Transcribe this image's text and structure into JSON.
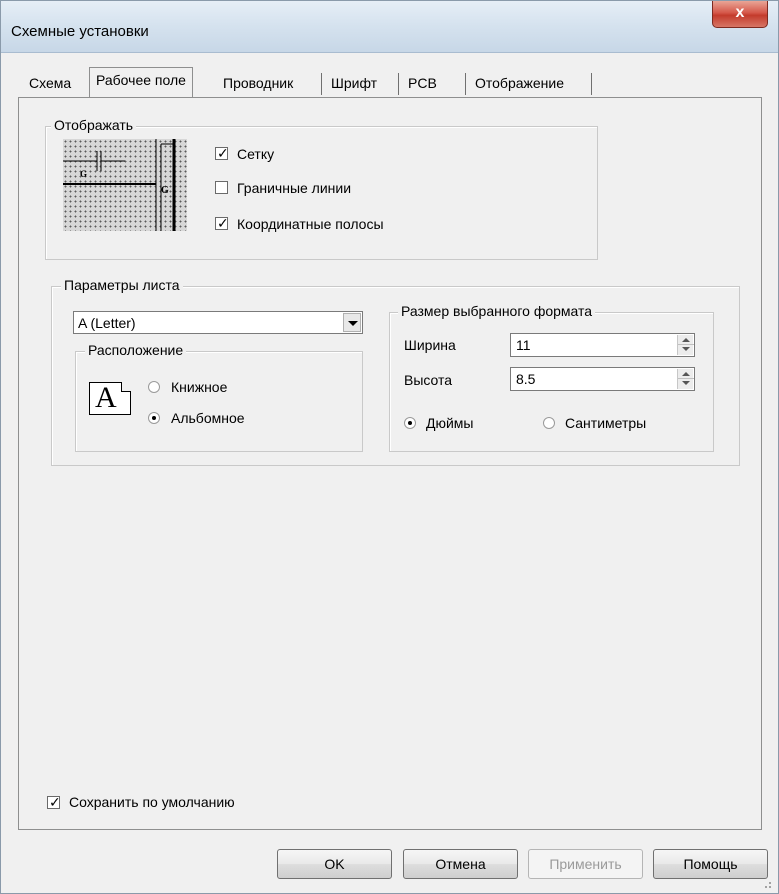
{
  "window": {
    "title": "Схемные установки",
    "close_label": "x"
  },
  "tabs": [
    {
      "label": "Схема"
    },
    {
      "label": "Рабочее поле",
      "active": true
    },
    {
      "label": "Проводник"
    },
    {
      "label": "Шрифт"
    },
    {
      "label": "PCB"
    },
    {
      "label": "Отображение"
    }
  ],
  "display_group": {
    "title": "Отображать",
    "preview_letters": {
      "left": "G",
      "right": "G"
    },
    "options": [
      {
        "label": "Сетку",
        "checked": true
      },
      {
        "label": "Граничные линии",
        "checked": false
      },
      {
        "label": "Координатные полосы",
        "checked": true
      }
    ]
  },
  "sheet_group": {
    "title": "Параметры листа",
    "format_select": {
      "value": "A (Letter)"
    },
    "orientation": {
      "title": "Расположение",
      "icon_letter": "A",
      "options": [
        {
          "label": "Книжное",
          "selected": false
        },
        {
          "label": "Альбомное",
          "selected": true
        }
      ]
    },
    "size": {
      "title": "Размер выбранного формата",
      "width_label": "Ширина",
      "width_value": "11",
      "height_label": "Высота",
      "height_value": "8.5",
      "units": [
        {
          "label": "Дюймы",
          "selected": true
        },
        {
          "label": "Сантиметры",
          "selected": false
        }
      ]
    }
  },
  "save_default": {
    "label": "Сохранить по умолчанию",
    "checked": true
  },
  "buttons": {
    "ok": "OK",
    "cancel": "Отмена",
    "apply": "Применить",
    "help": "Помощь"
  },
  "colors": {
    "window_bg": "#f0f0f0",
    "titlebar": "#d6e3ef",
    "close_button": "#c33b2c"
  }
}
